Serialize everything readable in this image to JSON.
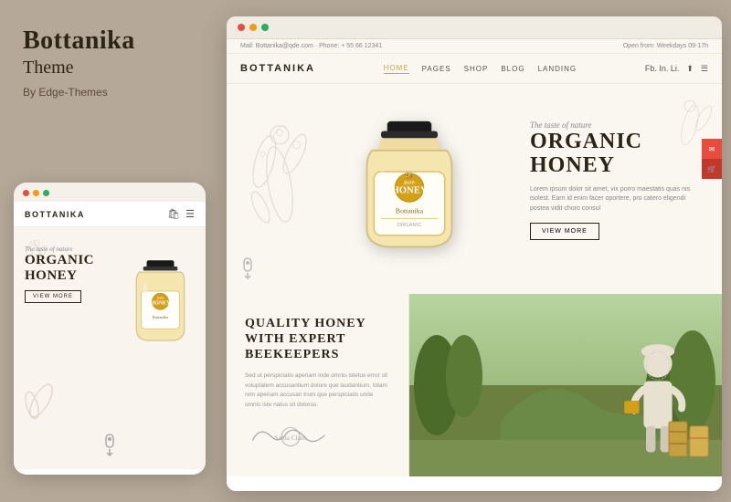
{
  "brand": {
    "title": "Bottanika",
    "subtitle": "Theme",
    "by": "By Edge-Themes"
  },
  "mobile": {
    "logo": "BOTTANIKA",
    "taste_label": "The taste of nature",
    "organic_line1": "ORGANIC",
    "organic_line2": "HONEY",
    "view_button": "VIEW MORE",
    "scroll_hint": "↓"
  },
  "desktop": {
    "topbar_left": "Mail: Bottanika@qde.com · Phone: + 55 66 12341",
    "topbar_right": "Open from: Weekdays 09-17h",
    "logo": "BOTTANIKA",
    "nav": {
      "home": "HOME",
      "pages": "PAGES",
      "shop": "SHOP",
      "blog": "BLOG",
      "landing": "LANDING"
    },
    "nav_right": "Fb. In. Li.",
    "hero": {
      "taste": "The taste of nature",
      "title_line1": "ORGANIC HONEY",
      "desc": "Lorem ipsum dolor sit amet, vix porro maestatis quas nis isolest. Earn id enim facer oportere, pro catero eligendi postea vidit choro consul",
      "view_button": "VIEW MORE"
    },
    "section2": {
      "title_line1": "QUALITY HONEY",
      "title_line2": "WITH EXPERT",
      "title_line3": "BEEKEEPERS",
      "desc": "Sed ut perspiciatis aperiam inde omnis istetus error sit voluptatem accusantium dolore que laudantium, totam rem aperiam accusan trum que perspiciatis unde omnis iste natus sit dolorus.",
      "signature": "Santa Claus"
    }
  }
}
